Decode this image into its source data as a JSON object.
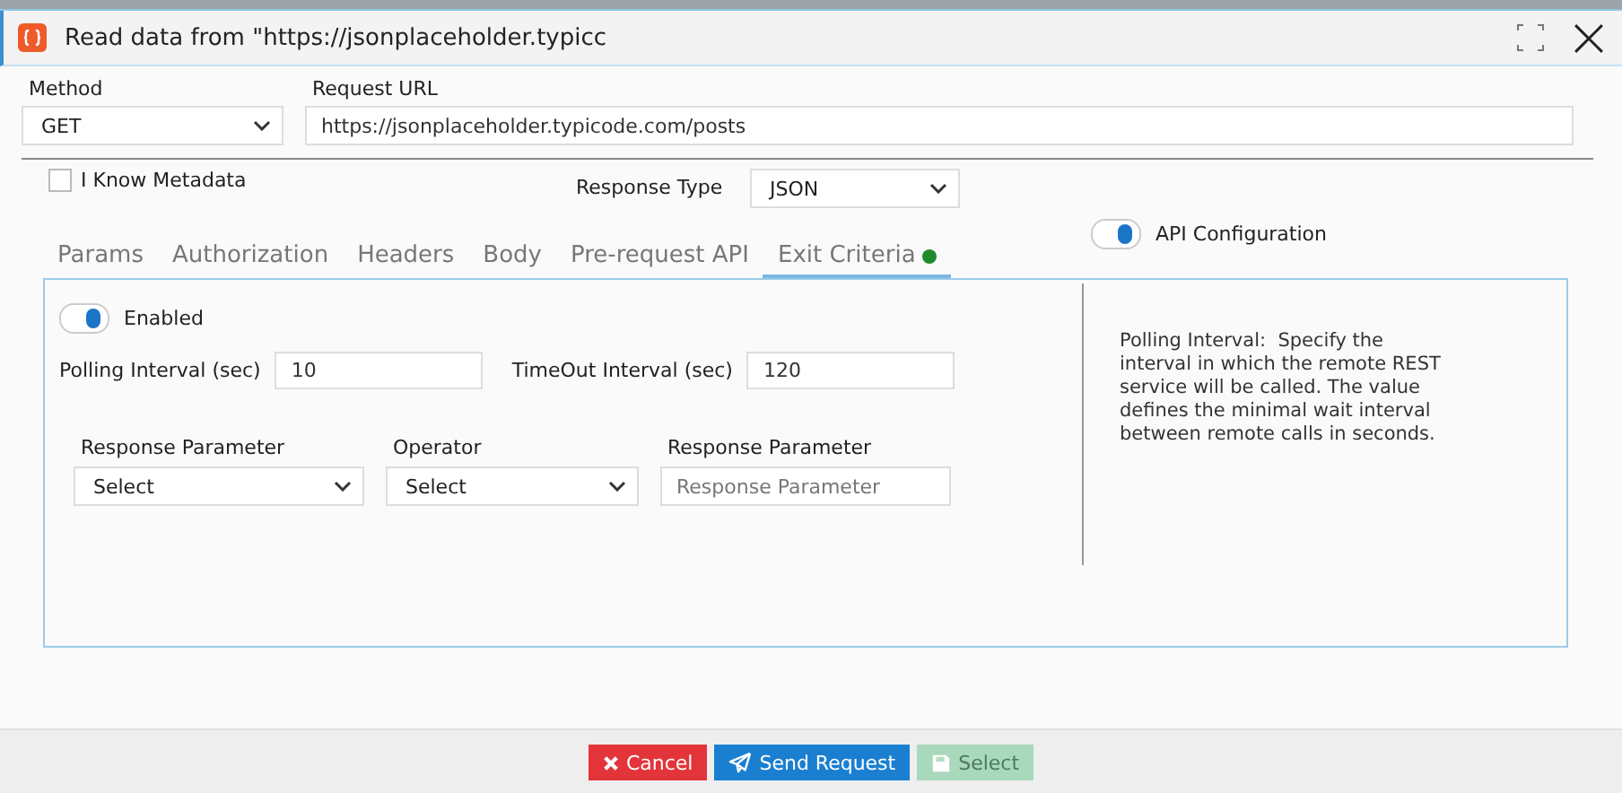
{
  "window": {
    "title": "Read data from \"https://jsonplaceholder.typicc"
  },
  "method": {
    "label": "Method",
    "value": "GET"
  },
  "request_url": {
    "label": "Request URL",
    "value": "https://jsonplaceholder.typicode.com/posts"
  },
  "know_metadata": {
    "label": "I Know Metadata",
    "checked": false
  },
  "response_type": {
    "label": "Response Type",
    "value": "JSON"
  },
  "tabs": [
    {
      "label": "Params",
      "selected": false
    },
    {
      "label": "Authorization",
      "selected": false
    },
    {
      "label": "Headers",
      "selected": false
    },
    {
      "label": "Body",
      "selected": false
    },
    {
      "label": "Pre-request API",
      "selected": false
    },
    {
      "label": "Exit Criteria",
      "selected": true,
      "color": "#1f8a2c"
    }
  ],
  "api_configuration": {
    "label": "API Configuration",
    "on": true
  },
  "exit_criteria": {
    "enabled": {
      "label": "Enabled",
      "on": true
    },
    "polling_interval": {
      "label": "Polling Interval (sec)",
      "value": "10"
    },
    "timeout_interval": {
      "label": "TimeOut Interval (sec)",
      "value": "120"
    },
    "condition": [
      {
        "kind": "select",
        "label": "Response Parameter",
        "value": "Select"
      },
      {
        "kind": "select",
        "label": "Operator",
        "value": "Select"
      },
      {
        "kind": "input",
        "label": "Response Parameter",
        "placeholder": "Response Parameter"
      }
    ],
    "help": "Polling Interval:  Specify the interval in which the remote REST service will be called. The value defines the minimal wait interval between remote calls in seconds."
  },
  "buttons": [
    {
      "kind": "cancel",
      "label": "Cancel",
      "disabled": false
    },
    {
      "kind": "send",
      "label": "Send Request",
      "disabled": false
    },
    {
      "kind": "select",
      "label": "Select",
      "disabled": true
    }
  ]
}
